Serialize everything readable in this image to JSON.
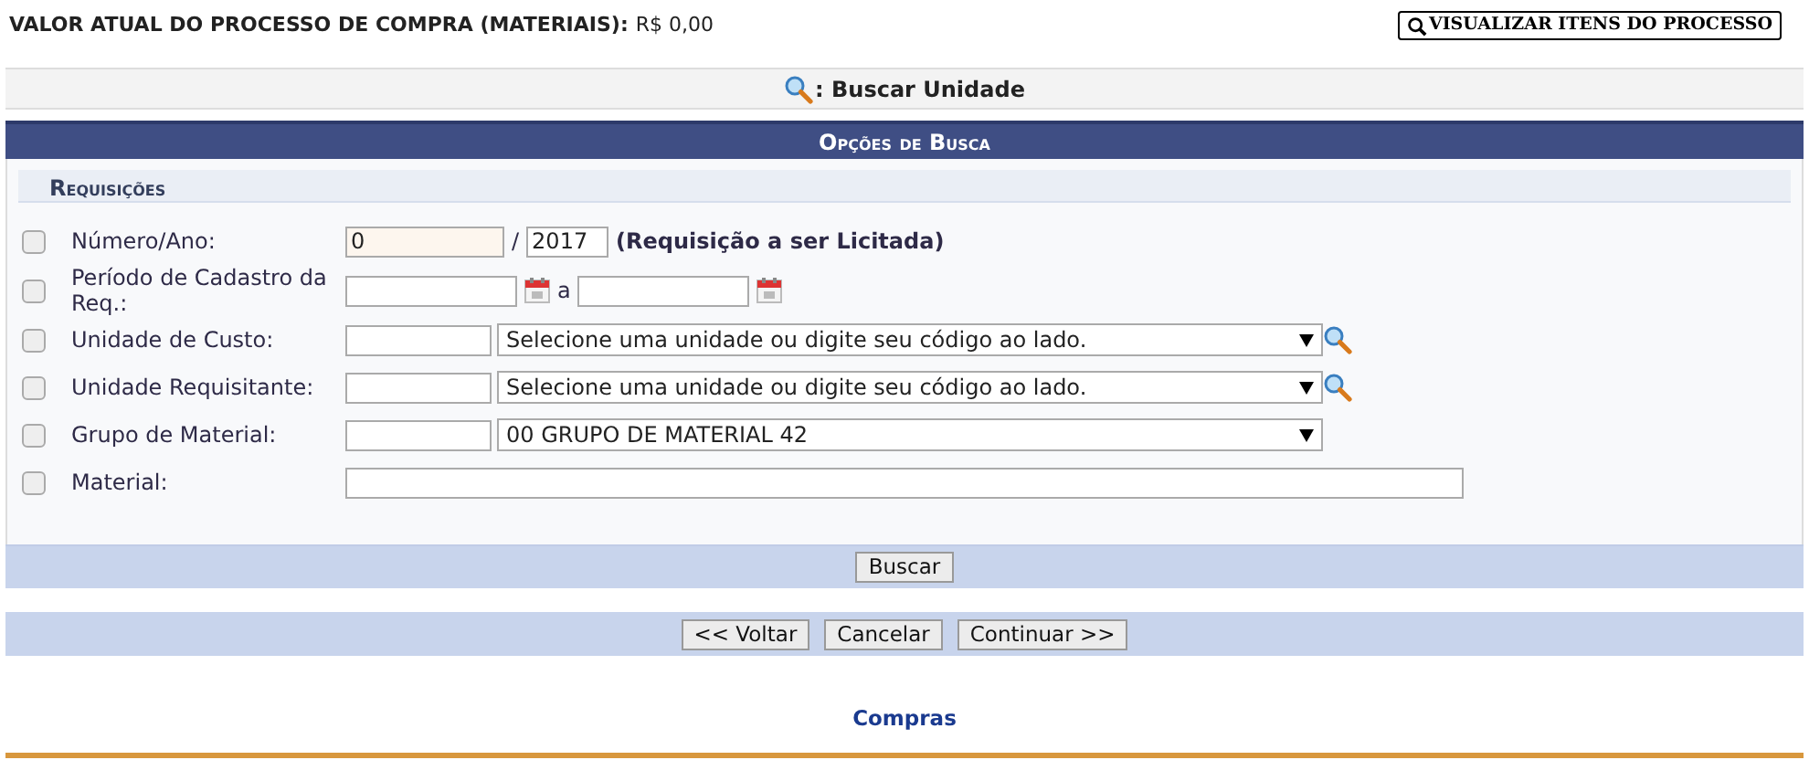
{
  "header": {
    "label": "VALOR ATUAL DO PROCESSO DE COMPRA (MATERIAIS):",
    "value": "R$ 0,00",
    "button": "VISUALIZAR ITENS DO PROCESSO"
  },
  "legend": {
    "text": ": Buscar Unidade"
  },
  "form": {
    "title": "Opções de Busca",
    "section": "Requisições",
    "rows": [
      {
        "kind": "number",
        "label": "Número/Ano:",
        "checked": false,
        "number": "0",
        "separator": "/",
        "year": "2017",
        "note": "(Requisição a ser Licitada)"
      },
      {
        "kind": "period",
        "label": "Período de Cadastro da Req.:",
        "checked": false,
        "connector": "a"
      },
      {
        "kind": "unit",
        "label": "Unidade de Custo:",
        "checked": false,
        "select": "Selecione uma unidade ou digite seu código ao lado."
      },
      {
        "kind": "unit",
        "label": "Unidade Requisitante:",
        "checked": false,
        "select": "Selecione uma unidade ou digite seu código ao lado."
      },
      {
        "kind": "group",
        "label": "Grupo de Material:",
        "checked": false,
        "select": "00 GRUPO DE MATERIAL 42"
      },
      {
        "kind": "text",
        "label": "Material:",
        "checked": false
      }
    ],
    "search_button": "Buscar"
  },
  "actions": [
    "<< Voltar",
    "Cancelar",
    "Continuar >>"
  ],
  "footer_link": "Compras"
}
